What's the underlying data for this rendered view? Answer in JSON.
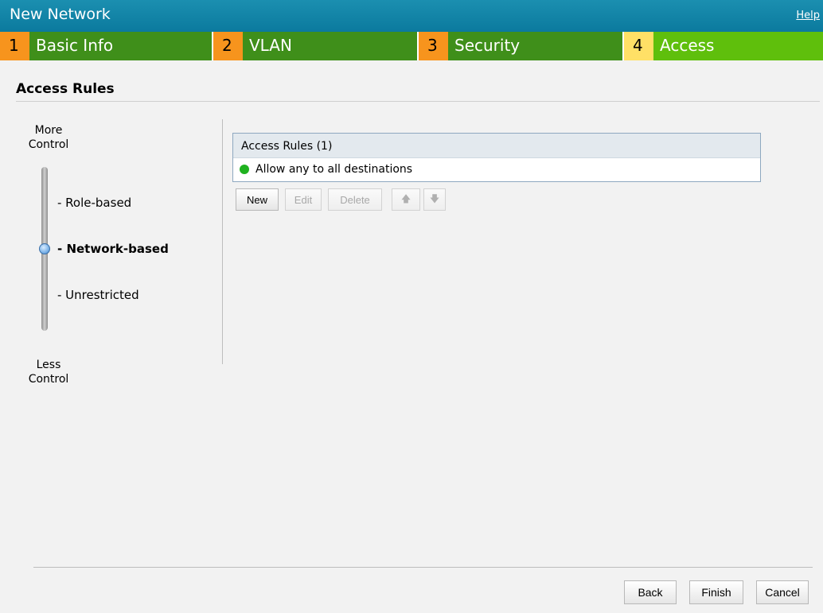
{
  "header": {
    "title": "New Network",
    "help_label": "Help"
  },
  "steps": [
    {
      "num": "1",
      "label": "Basic Info"
    },
    {
      "num": "2",
      "label": "VLAN"
    },
    {
      "num": "3",
      "label": "Security"
    },
    {
      "num": "4",
      "label": "Access"
    }
  ],
  "section": {
    "title": "Access Rules"
  },
  "slider": {
    "top_label": "More Control",
    "bottom_label": "Less Control",
    "options": [
      "- Role-based",
      "- Network-based",
      "- Unrestricted"
    ],
    "selected": "- Network-based"
  },
  "rules_table": {
    "header": "Access Rules (1)",
    "rows": [
      "Allow any to all destinations"
    ]
  },
  "rule_buttons": {
    "new": "New",
    "edit": "Edit",
    "delete": "Delete"
  },
  "footer": {
    "back": "Back",
    "finish": "Finish",
    "cancel": "Cancel"
  },
  "colors": {
    "titlebar": "#0b7a9e",
    "step_num": "#f7941d",
    "step_label": "#3f8f1a",
    "active_num": "#ffe066",
    "active_label": "#5fbf0c",
    "status_dot": "#1fb21f"
  }
}
